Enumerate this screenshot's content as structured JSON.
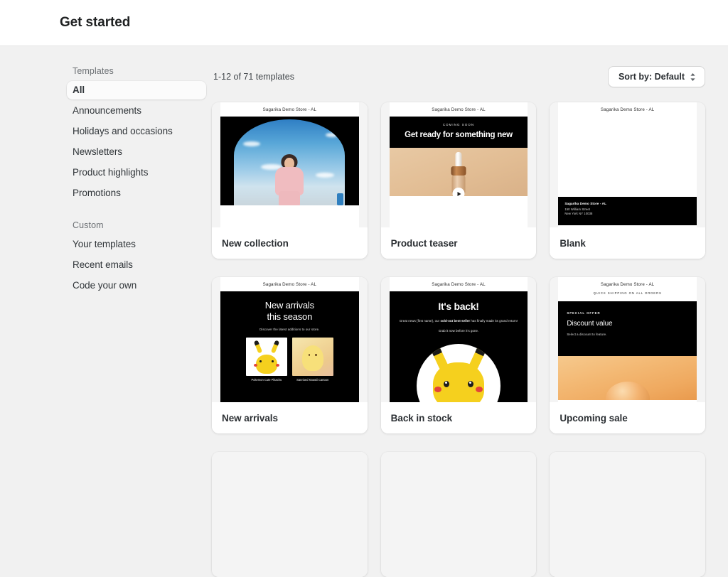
{
  "header": {
    "title": "Get started"
  },
  "sidebar": {
    "groups": [
      {
        "label": "Templates",
        "items": [
          {
            "label": "All",
            "selected": true
          },
          {
            "label": "Announcements",
            "selected": false
          },
          {
            "label": "Holidays and occasions",
            "selected": false
          },
          {
            "label": "Newsletters",
            "selected": false
          },
          {
            "label": "Product highlights",
            "selected": false
          },
          {
            "label": "Promotions",
            "selected": false
          }
        ]
      },
      {
        "label": "Custom",
        "items": [
          {
            "label": "Your templates",
            "selected": false
          },
          {
            "label": "Recent emails",
            "selected": false
          },
          {
            "label": "Code your own",
            "selected": false
          }
        ]
      }
    ]
  },
  "toolbar": {
    "results_count": "1-12 of 71 templates",
    "sort_label": "Sort by: Default",
    "sort_icon": "chevron-up-down-icon"
  },
  "store_name": "Sagarika Demo Store - AL",
  "cards": [
    {
      "title": "New collection",
      "store": "Sagarika Demo Store - AL"
    },
    {
      "title": "Product teaser",
      "store": "Sagarika Demo Store - AL",
      "eyebrow": "COMING SOON",
      "headline": "Get ready for something new",
      "play_icon": "play-icon"
    },
    {
      "title": "Blank",
      "store": "Sagarika Demo Store - AL",
      "footer_name": "Sagarika Demo Store - AL",
      "footer_address1": "150 William Street",
      "footer_address2": "New York NY 10038"
    },
    {
      "title": "New arrivals",
      "store": "Sagarika Demo Store - AL",
      "headline_line1": "New arrivals",
      "headline_line2": "this season",
      "subtitle": "Discover the latest additions to our store.",
      "products": [
        {
          "caption": "Pokemon Cute Pikachu"
        },
        {
          "caption": "Sanrioed Kawaii Cartoon"
        }
      ]
    },
    {
      "title": "Back in stock",
      "store": "Sagarika Demo Store - AL",
      "headline": "It's back!",
      "body_before": "Great news {first name}, our ",
      "body_bold": "sold-out best-seller",
      "body_after": " has finally made its grand return!",
      "body2": "Grab it now before it's gone."
    },
    {
      "title": "Upcoming sale",
      "store": "Sagarika Demo Store - AL",
      "shipping_bar": "QUICK SHIPPING ON ALL ORDERS",
      "eyebrow": "SPECIAL OFFER",
      "headline": "Discount value",
      "subtitle": "Select a discount to feature."
    }
  ],
  "colors": {
    "page_bg": "#f1f1f1",
    "header_bg": "#ffffff",
    "card_bg": "#ffffff",
    "text": "#202223",
    "muted_text": "#6d7175",
    "dark_preview": "#000000"
  }
}
